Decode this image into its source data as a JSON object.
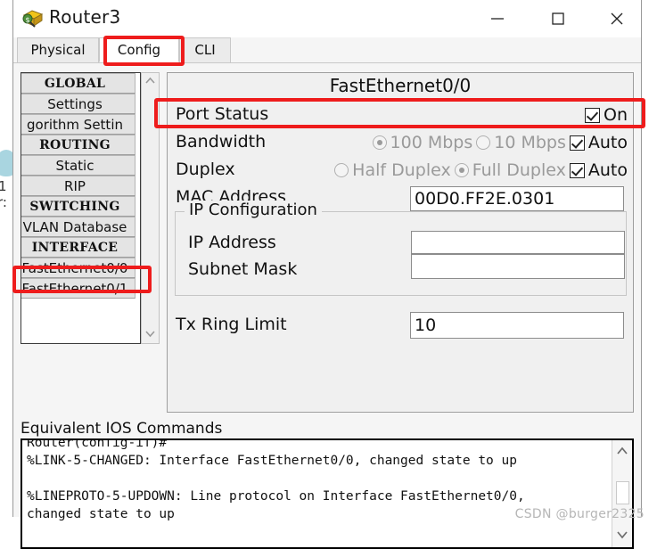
{
  "window": {
    "title": "Router3",
    "app_icon": "router-icon",
    "controls": {
      "minimize": "minimize-icon",
      "maximize": "maximize-icon",
      "close": "close-icon"
    }
  },
  "tabs": [
    {
      "label": "Physical",
      "active": false
    },
    {
      "label": "Config",
      "active": true
    },
    {
      "label": "CLI",
      "active": false
    }
  ],
  "sidebar": {
    "items": [
      {
        "label": "GLOBAL",
        "type": "header"
      },
      {
        "label": "Settings",
        "type": "item"
      },
      {
        "label": "gorithm Settin",
        "type": "item"
      },
      {
        "label": "ROUTING",
        "type": "header"
      },
      {
        "label": "Static",
        "type": "item"
      },
      {
        "label": "RIP",
        "type": "item"
      },
      {
        "label": "SWITCHING",
        "type": "header"
      },
      {
        "label": "VLAN Database",
        "type": "item"
      },
      {
        "label": "INTERFACE",
        "type": "header"
      },
      {
        "label": "FastEthernet0/0",
        "type": "item",
        "selected": true
      },
      {
        "label": "FastEthernet0/1",
        "type": "item"
      }
    ],
    "scrollbar": {
      "up": "chevron-up-icon",
      "down": "chevron-down-icon"
    }
  },
  "panel": {
    "title": "FastEthernet0/0",
    "port_status": {
      "label": "Port Status",
      "checkbox_label": "On",
      "checked": true
    },
    "bandwidth": {
      "label": "Bandwidth",
      "options": [
        {
          "label": "100 Mbps",
          "selected": true
        },
        {
          "label": "10 Mbps",
          "selected": false
        }
      ],
      "auto_label": "Auto",
      "auto_checked": true
    },
    "duplex": {
      "label": "Duplex",
      "options": [
        {
          "label": "Half Duplex",
          "selected": false
        },
        {
          "label": "Full Duplex",
          "selected": true
        }
      ],
      "auto_label": "Auto",
      "auto_checked": true
    },
    "mac_address": {
      "label": "MAC Address",
      "value": "00D0.FF2E.0301"
    },
    "ip_configuration": {
      "legend": "IP Configuration",
      "ip_address": {
        "label": "IP Address",
        "value": ""
      },
      "subnet_mask": {
        "label": "Subnet Mask",
        "value": ""
      }
    },
    "tx_ring_limit": {
      "label": "Tx Ring Limit",
      "value": "10"
    }
  },
  "console": {
    "label": "Equivalent IOS Commands",
    "text": "Router(config-if)#\n%LINK-5-CHANGED: Interface FastEthernet0/0, changed state to up\n\n%LINEPROTO-5-UPDOWN: Line protocol on Interface FastEthernet0/0,\nchanged state to up",
    "scrollbar": {
      "up": "chevron-up-icon",
      "down": "chevron-down-icon"
    }
  },
  "watermark": "CSDN @burger2325",
  "colors": {
    "annotation": "#ee1c1c",
    "panel_bg": "#f0f0f0",
    "window_bg": "#f5f5f5",
    "disabled_text": "#9a9a9a"
  }
}
